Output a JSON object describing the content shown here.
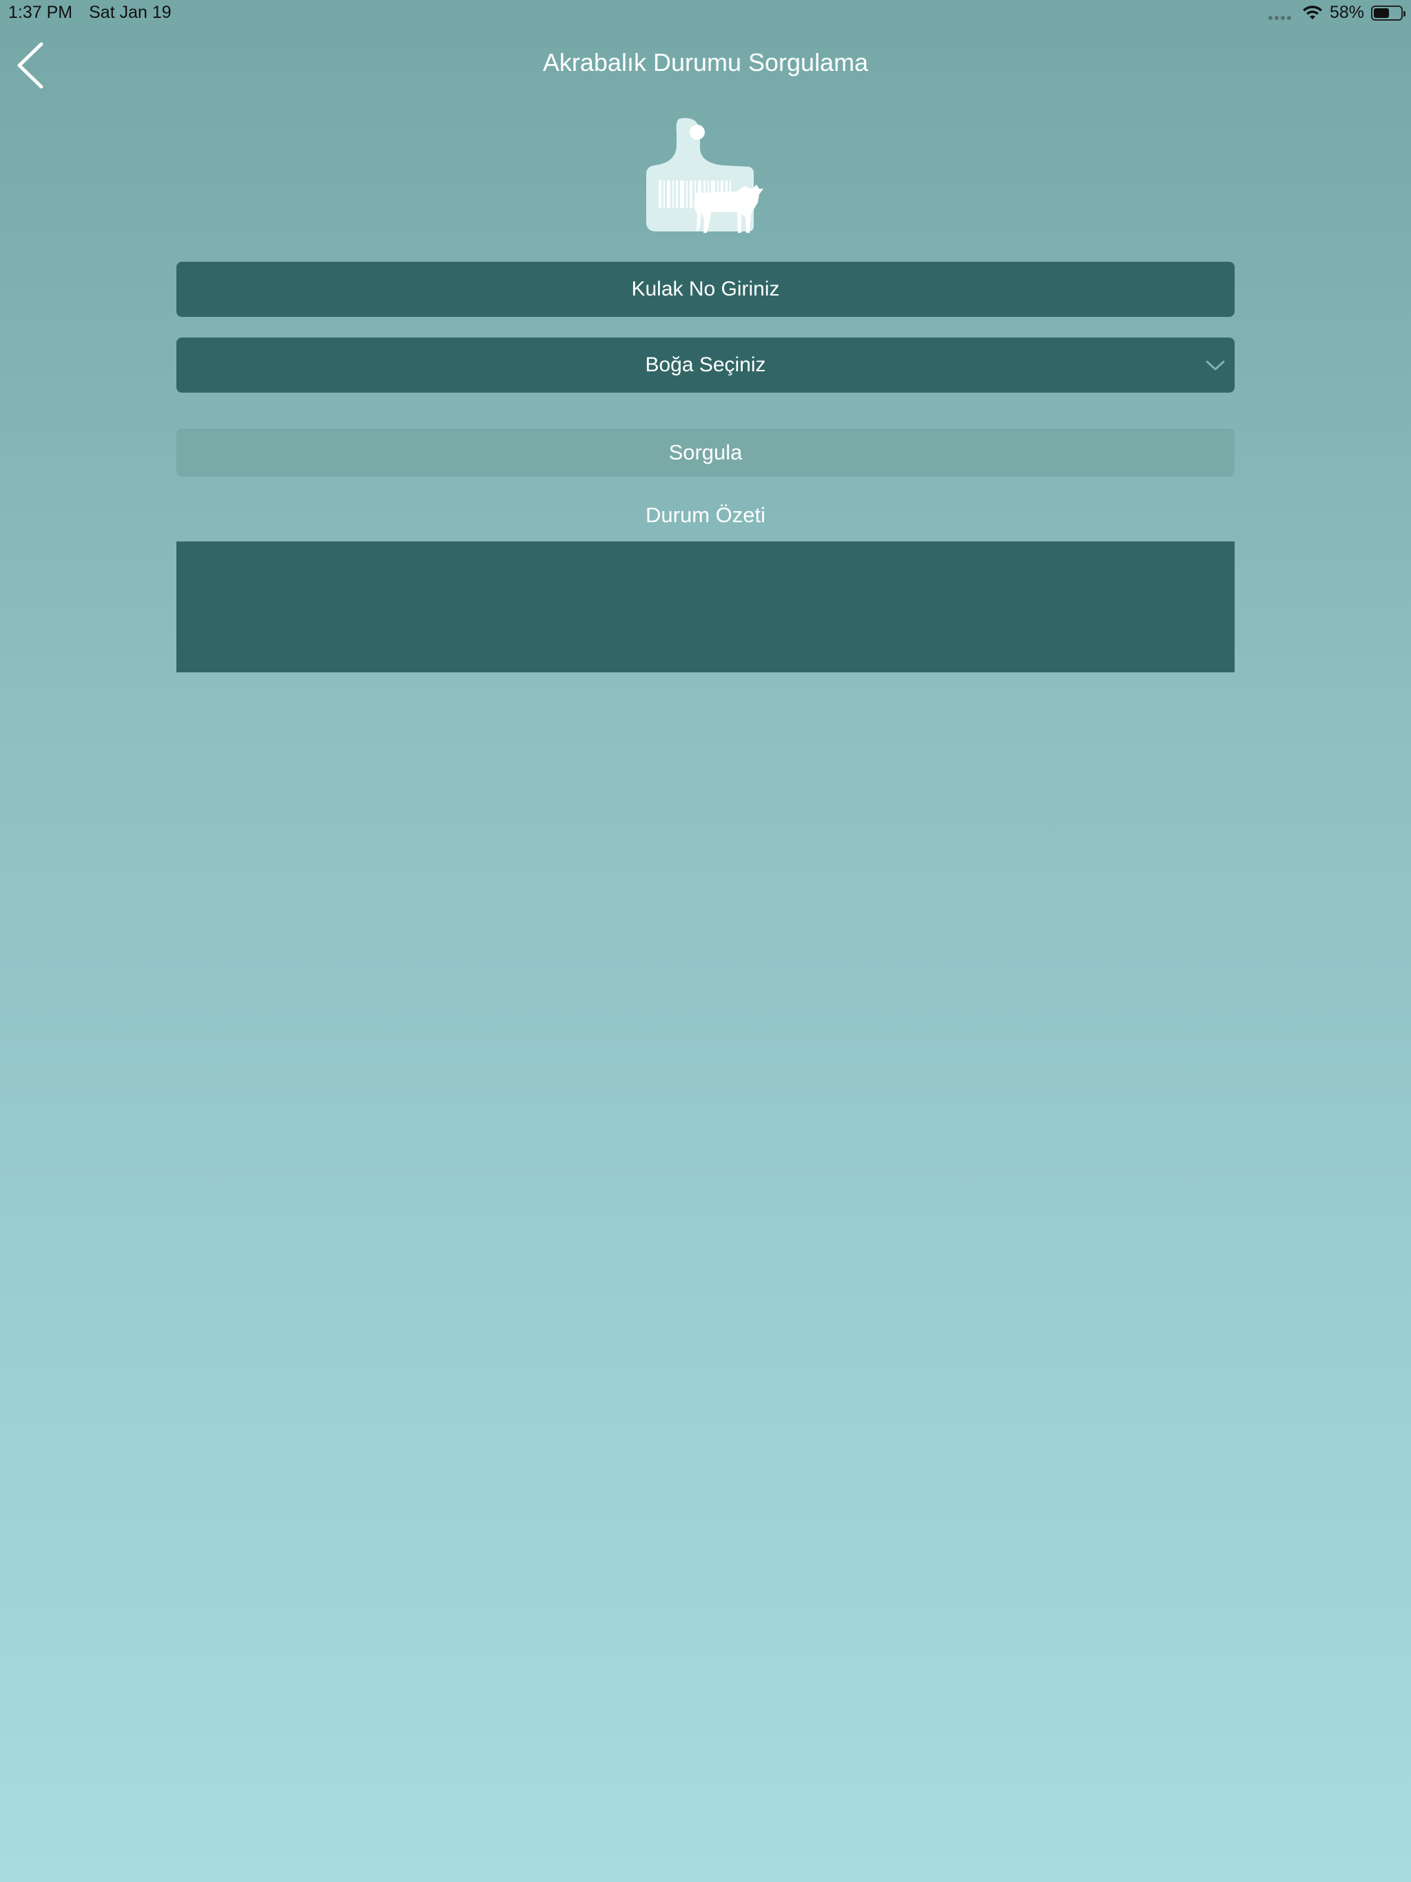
{
  "status_bar": {
    "time": "1:37 PM",
    "date": "Sat Jan 19",
    "battery_text": "58%",
    "battery_level": 0.58
  },
  "nav": {
    "title": "Akrabalık Durumu Sorgulama"
  },
  "form": {
    "ear_no_placeholder": "Kulak No Giriniz",
    "bull_select_label": "Boğa Seçiniz",
    "query_button_label": "Sorgula"
  },
  "summary": {
    "label": "Durum Özeti",
    "content": ""
  },
  "colors": {
    "field_bg": "#326566",
    "button_bg": "#7aaaa8",
    "gradient_top": "#75a7a7",
    "gradient_bottom": "#a6dcdf"
  },
  "icons": {
    "back": "chevron-left-icon",
    "logo": "ear-tag-cow-icon",
    "dropdown": "chevron-down-icon",
    "wifi": "wifi-icon",
    "battery": "battery-icon"
  }
}
